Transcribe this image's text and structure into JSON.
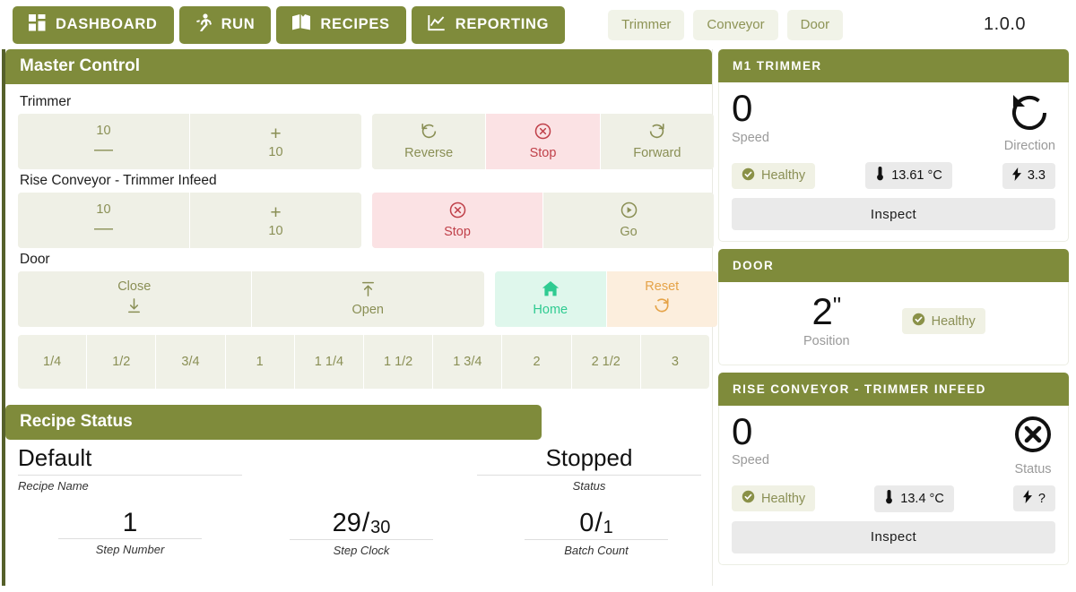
{
  "topnav": {
    "items": [
      {
        "label": "DASHBOARD",
        "icon": "dashboard-grid-icon"
      },
      {
        "label": "RUN",
        "icon": "running-person-icon"
      },
      {
        "label": "RECIPES",
        "icon": "open-book-icon"
      },
      {
        "label": "REPORTING",
        "icon": "line-chart-icon"
      }
    ],
    "pills": [
      {
        "label": "Trimmer"
      },
      {
        "label": "Conveyor"
      },
      {
        "label": "Door"
      }
    ],
    "version": "1.0.0"
  },
  "master_control": {
    "title": "Master Control",
    "trimmer": {
      "label": "Trimmer",
      "dec_value": "10",
      "dec_glyph": "—",
      "inc_glyph": "+",
      "inc_value": "10",
      "reverse": "Reverse",
      "stop": "Stop",
      "forward": "Forward"
    },
    "conveyor": {
      "label": "Rise Conveyor - Trimmer Infeed",
      "dec_value": "10",
      "dec_glyph": "—",
      "inc_glyph": "+",
      "inc_value": "10",
      "stop": "Stop",
      "go": "Go"
    },
    "door": {
      "label": "Door",
      "close": "Close",
      "open": "Open",
      "home": "Home",
      "reset": "Reset",
      "presets": [
        "1/4",
        "1/2",
        "3/4",
        "1",
        "1 1/4",
        "1 1/2",
        "1 3/4",
        "2",
        "2 1/2",
        "3"
      ]
    }
  },
  "recipe_status": {
    "title": "Recipe Status",
    "recipe_name_value": "Default",
    "recipe_name_caption": "Recipe Name",
    "status_value": "Stopped",
    "status_caption": "Status",
    "step_number_value": "1",
    "step_number_caption": "Step Number",
    "step_clock_num": "29",
    "step_clock_sep": "/",
    "step_clock_den": "30",
    "step_clock_caption": "Step Clock",
    "batch_count_num": "0",
    "batch_count_sep": "/",
    "batch_count_den": "1",
    "batch_count_caption": "Batch Count"
  },
  "sidebar": {
    "cards": [
      {
        "title": "M1 TRIMMER",
        "speed_value": "0",
        "speed_caption": "Speed",
        "right_caption": "Direction",
        "right_icon": "rotate-counterclockwise-icon",
        "health": "Healthy",
        "temp": "13.61 °C",
        "power": "3.3",
        "inspect": "Inspect"
      },
      {
        "title": "DOOR",
        "position_value": "2",
        "position_unit": "\"",
        "position_caption": "Position",
        "health": "Healthy"
      },
      {
        "title": "RISE CONVEYOR - TRIMMER INFEED",
        "speed_value": "0",
        "speed_caption": "Speed",
        "right_caption": "Status",
        "right_icon": "circle-x-icon",
        "health": "Healthy",
        "temp": "13.4 °C",
        "power": "?",
        "inspect": "Inspect"
      }
    ]
  },
  "colors": {
    "brand_olive": "#7f8b3b",
    "danger_bg": "#fbe2e4",
    "danger_fg": "#c0414a",
    "home_bg": "#dff7ec",
    "home_fg": "#2fcb91",
    "reset_bg": "#fceedd",
    "reset_fg": "#e5a348",
    "surface": "#eff0e6"
  }
}
